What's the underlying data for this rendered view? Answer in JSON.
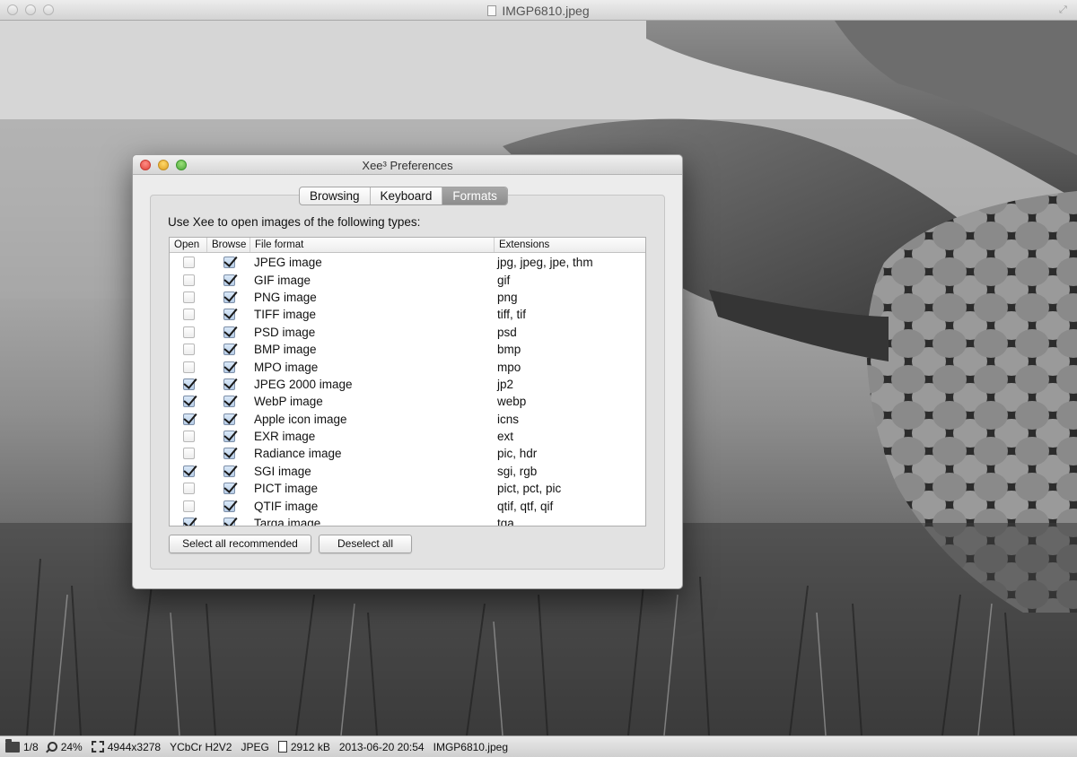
{
  "window": {
    "title": "IMGP6810.jpeg"
  },
  "dialog": {
    "title": "Xee³ Preferences",
    "tabs": [
      {
        "label": "Browsing",
        "selected": false
      },
      {
        "label": "Keyboard",
        "selected": false
      },
      {
        "label": "Formats",
        "selected": true
      }
    ],
    "instruction": "Use Xee to open images of the following types:",
    "columns": {
      "open": "Open",
      "browse": "Browse",
      "format": "File format",
      "extensions": "Extensions"
    },
    "rows": [
      {
        "open": false,
        "browse": true,
        "format": "JPEG image",
        "extensions": "jpg, jpeg, jpe, thm"
      },
      {
        "open": false,
        "browse": true,
        "format": "GIF image",
        "extensions": "gif"
      },
      {
        "open": false,
        "browse": true,
        "format": "PNG image",
        "extensions": "png"
      },
      {
        "open": false,
        "browse": true,
        "format": "TIFF image",
        "extensions": "tiff, tif"
      },
      {
        "open": false,
        "browse": true,
        "format": "PSD image",
        "extensions": "psd"
      },
      {
        "open": false,
        "browse": true,
        "format": "BMP image",
        "extensions": "bmp"
      },
      {
        "open": false,
        "browse": true,
        "format": "MPO image",
        "extensions": "mpo"
      },
      {
        "open": true,
        "browse": true,
        "format": "JPEG 2000 image",
        "extensions": "jp2"
      },
      {
        "open": true,
        "browse": true,
        "format": "WebP image",
        "extensions": "webp"
      },
      {
        "open": true,
        "browse": true,
        "format": "Apple icon image",
        "extensions": "icns"
      },
      {
        "open": false,
        "browse": true,
        "format": "EXR image",
        "extensions": "ext"
      },
      {
        "open": false,
        "browse": true,
        "format": "Radiance image",
        "extensions": "pic, hdr"
      },
      {
        "open": true,
        "browse": true,
        "format": "SGI image",
        "extensions": "sgi, rgb"
      },
      {
        "open": false,
        "browse": true,
        "format": "PICT image",
        "extensions": "pict, pct, pic"
      },
      {
        "open": false,
        "browse": true,
        "format": "QTIF image",
        "extensions": "qtif, qtf, qif"
      },
      {
        "open": true,
        "browse": true,
        "format": "Targa image",
        "extensions": "tga"
      }
    ],
    "buttons": {
      "select_all": "Select all recommended",
      "deselect_all": "Deselect all"
    }
  },
  "statusbar": {
    "position": "1/8",
    "zoom": "24%",
    "dimensions": "4944x3278",
    "color_format": "YCbCr H2V2",
    "file_type": "JPEG",
    "file_size": "2912 kB",
    "date": "2013-06-20 20:54",
    "filename": "IMGP6810.jpeg"
  }
}
